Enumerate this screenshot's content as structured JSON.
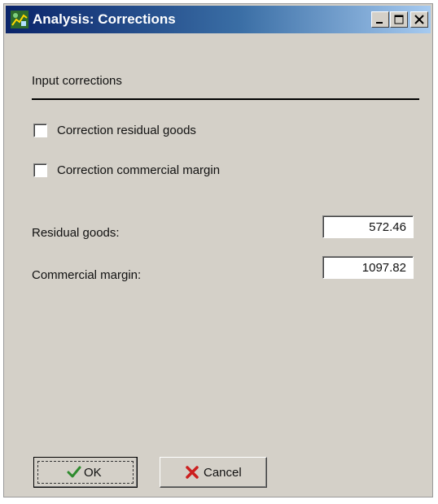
{
  "window": {
    "title": "Analysis: Corrections"
  },
  "section": {
    "label": "Input corrections"
  },
  "checkboxes": [
    {
      "label": "Correction residual goods",
      "checked": false
    },
    {
      "label": "Correction commercial margin",
      "checked": false
    }
  ],
  "fields": [
    {
      "label": "Residual goods:",
      "value": "572.46"
    },
    {
      "label": "Commercial margin:",
      "value": "1097.82"
    }
  ],
  "buttons": {
    "ok_label": "OK",
    "cancel_label": "Cancel"
  },
  "colors": {
    "titlebar_start": "#0a246a",
    "titlebar_end": "#a6caf0",
    "face": "#d4d0c8",
    "ok_icon": "#2e8b2e",
    "cancel_icon": "#cc1f1f"
  },
  "icons": {
    "app": "analysis-app-icon",
    "minimize": "minimize-icon",
    "maximize": "maximize-icon",
    "close": "close-icon",
    "ok": "checkmark-icon",
    "cancel": "cross-icon"
  }
}
